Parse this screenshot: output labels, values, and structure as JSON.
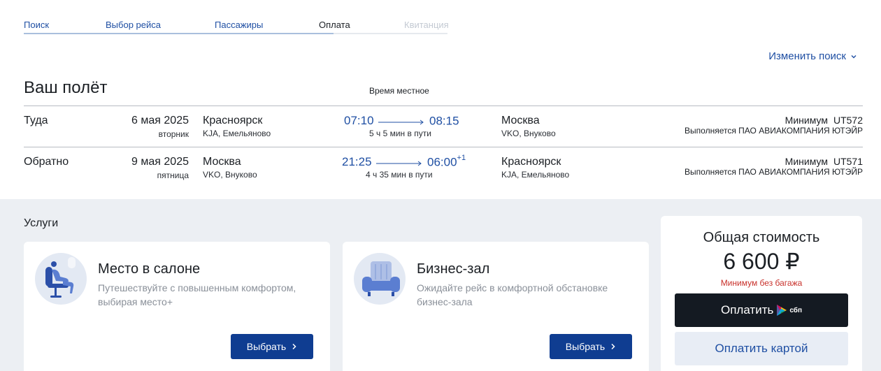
{
  "steps": [
    {
      "label": "Поиск",
      "state": "done"
    },
    {
      "label": "Выбор рейса",
      "state": "done"
    },
    {
      "label": "Пассажиры",
      "state": "done"
    },
    {
      "label": "Оплата",
      "state": "active"
    },
    {
      "label": "Квитанция",
      "state": "todo"
    }
  ],
  "header": {
    "change_search": "Изменить поиск",
    "title": "Ваш полёт",
    "local_time": "Время местное"
  },
  "flights": [
    {
      "direction": "Туда",
      "date": "6 мая 2025",
      "weekday": "вторник",
      "from_city": "Красноярск",
      "from_airport": "KJA, Емельяново",
      "dep_time": "07:10",
      "arr_time": "08:15",
      "arr_next_day": "",
      "duration": "5 ч 5 мин в пути",
      "to_city": "Москва",
      "to_airport": "VKO, Внуково",
      "tariff": "Минимум",
      "flight_no": "UT572",
      "operator": "Выполняется ПАО АВИАКОМПАНИЯ ЮТЭЙР"
    },
    {
      "direction": "Обратно",
      "date": "9 мая 2025",
      "weekday": "пятница",
      "from_city": "Москва",
      "from_airport": "VKO, Внуково",
      "dep_time": "21:25",
      "arr_time": "06:00",
      "arr_next_day": "+1",
      "duration": "4 ч 35 мин в пути",
      "to_city": "Красноярск",
      "to_airport": "KJA, Емельяново",
      "tariff": "Минимум",
      "flight_no": "UT571",
      "operator": "Выполняется ПАО АВИАКОМПАНИЯ ЮТЭЙР"
    }
  ],
  "services": {
    "label": "Услуги",
    "items": [
      {
        "title": "Место в салоне",
        "desc": "Путешествуйте с повышенным комфортом, выбирая место+",
        "button": "Выбрать",
        "icon": "seat-icon"
      },
      {
        "title": "Бизнес-зал",
        "desc": "Ожидайте рейс в комфортной обстановке бизнес-зала",
        "button": "Выбрать",
        "icon": "armchair-icon"
      }
    ]
  },
  "total": {
    "label": "Общая стоимость",
    "price": "6 600 ₽",
    "note": "Минимум без багажа",
    "pay_sbp": "Оплатить",
    "sbp_logo_text": "сбп",
    "pay_card": "Оплатить картой"
  },
  "colors": {
    "accent": "#1f4fa3",
    "primary_button": "#0f3d91",
    "dark_button": "#141a22",
    "warning": "#c8312b",
    "section_bg": "#eceff3"
  }
}
